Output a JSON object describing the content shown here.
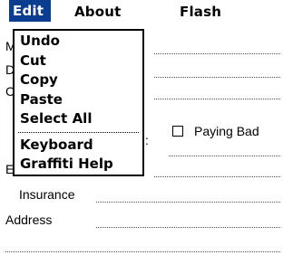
{
  "menubar": {
    "items": [
      {
        "label": "Edit"
      },
      {
        "label": "About"
      },
      {
        "label": "Flash"
      }
    ]
  },
  "edit_menu": {
    "group1": [
      {
        "label": "Undo"
      },
      {
        "label": "Cut"
      },
      {
        "label": "Copy"
      },
      {
        "label": "Paste"
      },
      {
        "label": "Select All"
      }
    ],
    "group2": [
      {
        "label": "Keyboard"
      },
      {
        "label": "Graffiti Help"
      }
    ]
  },
  "form": {
    "partial_labels": [
      "M",
      "D",
      "C",
      ":",
      "E"
    ],
    "checkbox_label": "Paying Bad",
    "insurance_label": "Insurance",
    "address_label": "Address"
  },
  "colors": {
    "highlight": "#0a3d8f"
  }
}
